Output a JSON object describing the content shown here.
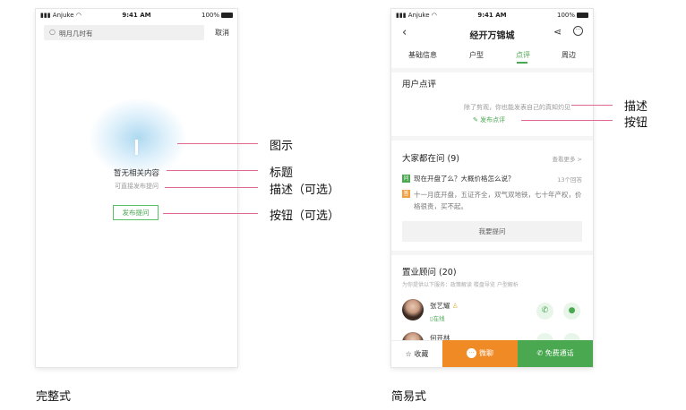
{
  "full_style": {
    "status": {
      "carrier": "Anjuke",
      "time": "9:41 AM",
      "battery": "100%"
    },
    "search_placeholder": "明月几时有",
    "cancel_label": "取消",
    "empty_title": "暂无相关内容",
    "empty_desc": "可直接发布提问",
    "empty_button": "发布提问",
    "caption": "完整式"
  },
  "annotations": {
    "illustration": "图示",
    "title": "标题",
    "desc_optional": "描述（可选）",
    "button_optional": "按钮（可选）",
    "desc": "描述",
    "button": "按钮"
  },
  "simple_style": {
    "status": {
      "carrier": "Anjuke",
      "time": "9:41 AM",
      "battery": "100%"
    },
    "nav_title": "经开万锦城",
    "tabs": [
      {
        "label": "基础信息",
        "active": false
      },
      {
        "label": "户型",
        "active": false
      },
      {
        "label": "点评",
        "active": true
      },
      {
        "label": "周边",
        "active": false
      }
    ],
    "review": {
      "title": "用户点评",
      "hint": "除了剪观，你也能发表自己的真知灼见",
      "button": "发布点评"
    },
    "qa": {
      "title": "大家都在问 (9)",
      "see_more": "查看更多 >",
      "question_badge": "问",
      "question": "现在开盘了么？大概价格怎么说？",
      "answer_count": "13个回答",
      "answer_badge": "答",
      "answer": "十一月底开盘，五证齐全，双气双地铁，七十年产权，价格很贵，买不起。",
      "ask_button": "我要提问"
    },
    "consultants": {
      "title": "置业顾问 (20)",
      "subtitle": "为你提供以下服务：政策解读 楼盘导览 户型解析",
      "items": [
        {
          "name": "张艺耀",
          "status": "在线"
        },
        {
          "name": "何开林",
          "status": ""
        }
      ]
    },
    "bottom_bar": {
      "favorite": "收藏",
      "wechat": "微聊",
      "call": "免费通话"
    },
    "caption": "简易式"
  },
  "colors": {
    "accent_green": "#4aa851",
    "accent_orange": "#f08a24",
    "annotation_line": "#e06a8e"
  }
}
